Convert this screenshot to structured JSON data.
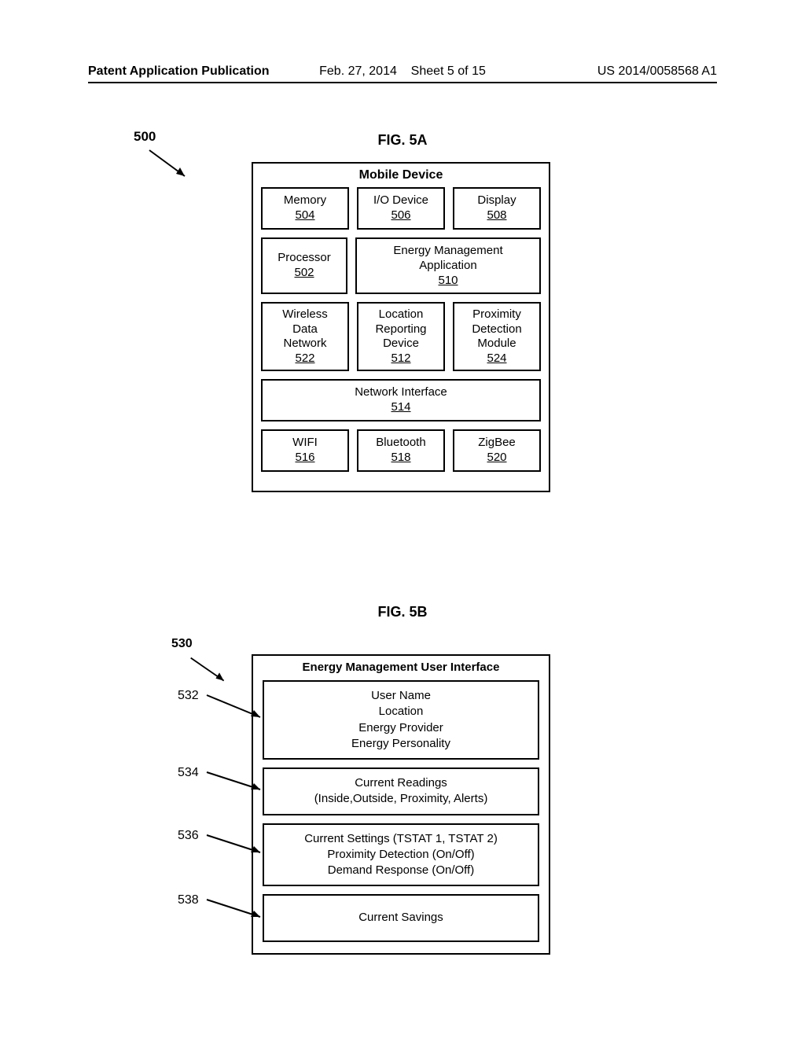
{
  "header": {
    "left": "Patent Application Publication",
    "center_date": "Feb. 27, 2014",
    "center_sheet": "Sheet 5 of 15",
    "right": "US 2014/0058568 A1"
  },
  "fig5a": {
    "title": "FIG. 5A",
    "ref": "500",
    "device_title": "Mobile Device",
    "memory": {
      "label": "Memory",
      "ref": "504"
    },
    "io": {
      "label": "I/O Device",
      "ref": "506"
    },
    "display": {
      "label": "Display",
      "ref": "508"
    },
    "processor": {
      "label": "Processor",
      "ref": "502"
    },
    "emapp": {
      "label_l1": "Energy Management",
      "label_l2": "Application",
      "ref": "510"
    },
    "wdn": {
      "label_l1": "Wireless",
      "label_l2": "Data",
      "label_l3": "Network",
      "ref": "522"
    },
    "lrd": {
      "label_l1": "Location",
      "label_l2": "Reporting",
      "label_l3": "Device",
      "ref": "512"
    },
    "pdm": {
      "label_l1": "Proximity",
      "label_l2": "Detection",
      "label_l3": "Module",
      "ref": "524"
    },
    "netif": {
      "label": "Network Interface",
      "ref": "514"
    },
    "wifi": {
      "label": "WIFI",
      "ref": "516"
    },
    "bt": {
      "label": "Bluetooth",
      "ref": "518"
    },
    "zb": {
      "label": "ZigBee",
      "ref": "520"
    }
  },
  "fig5b": {
    "title": "FIG. 5B",
    "ref": "530",
    "ui_title": "Energy Management  User Interface",
    "p1": {
      "ref": "532",
      "l1": "User Name",
      "l2": "Location",
      "l3": "Energy Provider",
      "l4": "Energy Personality"
    },
    "p2": {
      "ref": "534",
      "l1": "Current Readings",
      "l2": "(Inside,Outside, Proximity, Alerts)"
    },
    "p3": {
      "ref": "536",
      "l1": "Current Settings (TSTAT 1, TSTAT 2)",
      "l2": "Proximity Detection (On/Off)",
      "l3": "Demand Response (On/Off)"
    },
    "p4": {
      "ref": "538",
      "l1": "Current Savings"
    }
  }
}
